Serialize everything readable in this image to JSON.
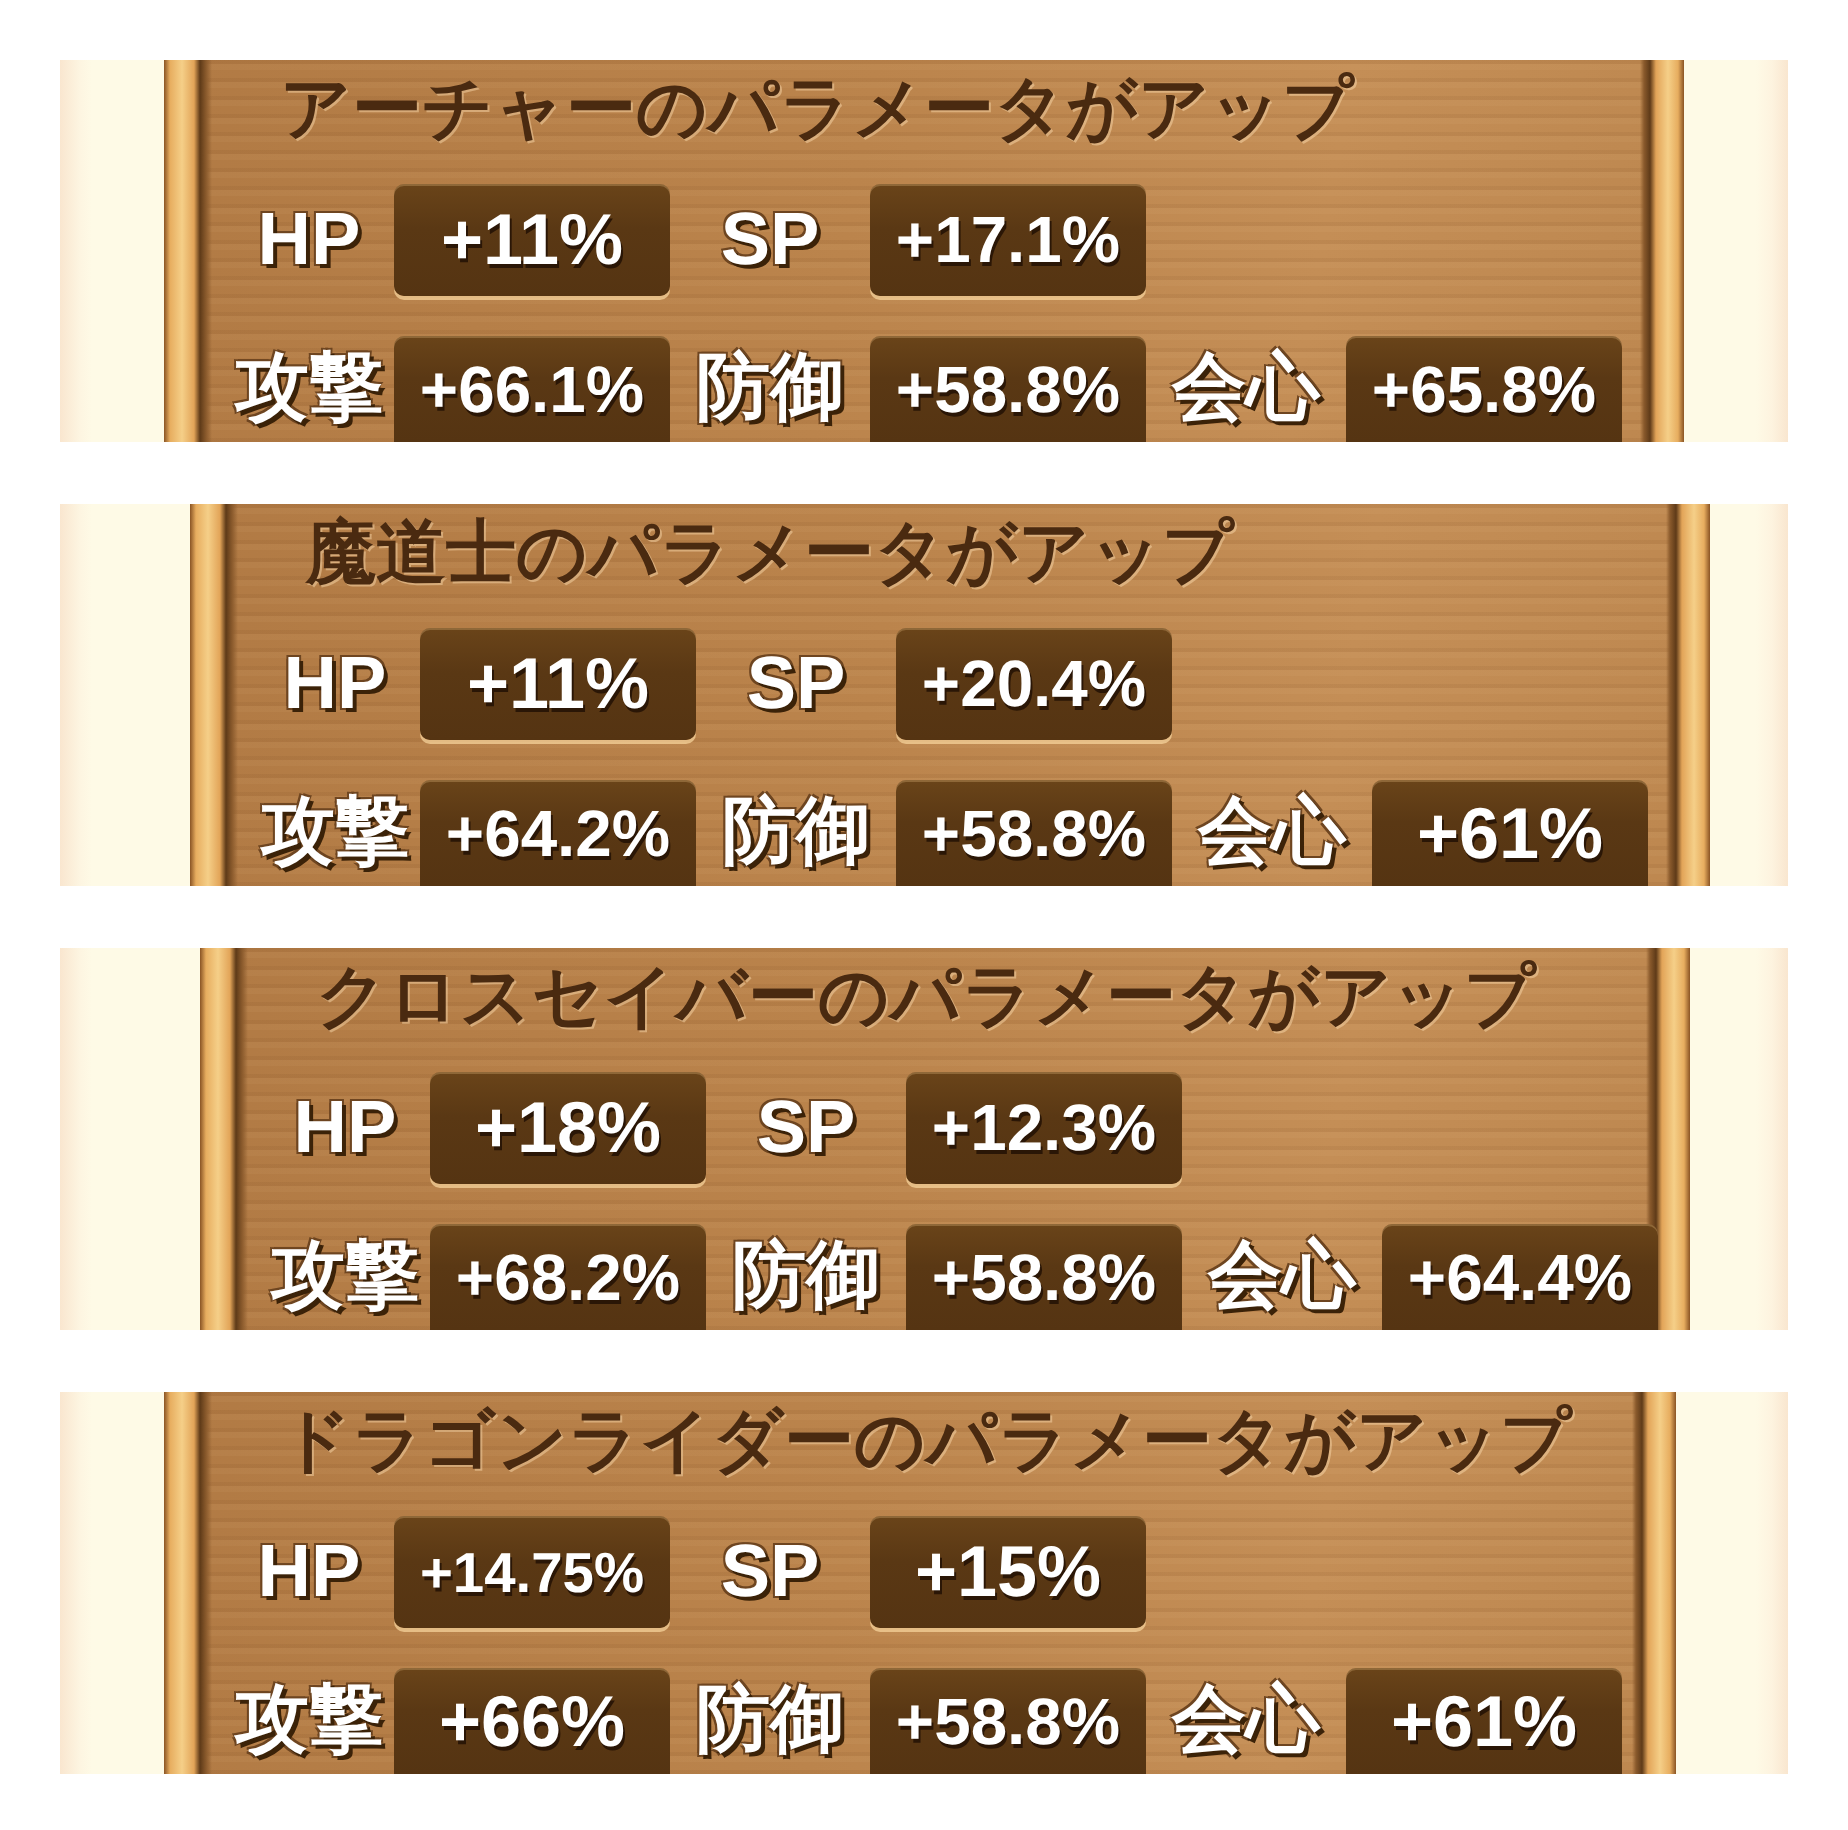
{
  "panels": [
    {
      "title": "アーチャーのパラメータがアップ",
      "rows": [
        [
          {
            "label": "HP",
            "value": "+11%"
          },
          {
            "label": "SP",
            "value": "+17.1%"
          }
        ],
        [
          {
            "label": "攻撃",
            "value": "+66.1%"
          },
          {
            "label": "防御",
            "value": "+58.8%"
          },
          {
            "label": "会心",
            "value": "+65.8%"
          }
        ]
      ]
    },
    {
      "title": "魔道士のパラメータがアップ",
      "rows": [
        [
          {
            "label": "HP",
            "value": "+11%"
          },
          {
            "label": "SP",
            "value": "+20.4%"
          }
        ],
        [
          {
            "label": "攻撃",
            "value": "+64.2%"
          },
          {
            "label": "防御",
            "value": "+58.8%"
          },
          {
            "label": "会心",
            "value": "+61%"
          }
        ]
      ]
    },
    {
      "title": "クロスセイバーのパラメータがアップ",
      "rows": [
        [
          {
            "label": "HP",
            "value": "+18%"
          },
          {
            "label": "SP",
            "value": "+12.3%"
          }
        ],
        [
          {
            "label": "攻撃",
            "value": "+68.2%"
          },
          {
            "label": "防御",
            "value": "+58.8%"
          },
          {
            "label": "会心",
            "value": "+64.4%"
          }
        ]
      ]
    },
    {
      "title": "ドラゴンライダーのパラメータがアップ",
      "rows": [
        [
          {
            "label": "HP",
            "value": "+14.75%"
          },
          {
            "label": "SP",
            "value": "+15%"
          }
        ],
        [
          {
            "label": "攻撃",
            "value": "+66%"
          },
          {
            "label": "防御",
            "value": "+58.8%"
          },
          {
            "label": "会心",
            "value": "+61%"
          }
        ]
      ]
    }
  ]
}
